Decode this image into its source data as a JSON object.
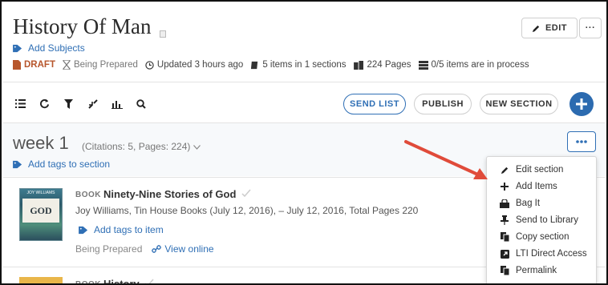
{
  "header": {
    "title": "History Of Man",
    "edit_label": "EDIT",
    "more_label": "···",
    "add_subjects": "Add Subjects"
  },
  "status": {
    "draft": "DRAFT",
    "being_prepared": "Being Prepared",
    "updated": "Updated 3 hours ago",
    "items": "5 items in 1 sections",
    "pages": "224 Pages",
    "process": "0/5 items are in process"
  },
  "toolbar": {
    "send_list": "SEND LIST",
    "publish": "PUBLISH",
    "new_section": "NEW SECTION"
  },
  "section": {
    "title": "week 1",
    "meta": "(Citations: 5, Pages: 224)",
    "add_tags": "Add tags to section"
  },
  "items": [
    {
      "type": "BOOK",
      "title": "Ninety-Nine Stories of God",
      "subtitle": "Joy Williams, Tin House Books (July 12, 2016), – July 12, 2016, Total Pages 220",
      "add_tags": "Add tags to item",
      "status": "Being Prepared",
      "view_online": "View online",
      "cover_text": "GOD",
      "cover_small": "JOY WILLIAMS"
    },
    {
      "type": "BOOK",
      "title": "History"
    }
  ],
  "menu": {
    "items": [
      {
        "label": "Edit section",
        "icon": "pencil-icon"
      },
      {
        "label": "Add Items",
        "icon": "plus-icon"
      },
      {
        "label": "Bag It",
        "icon": "bag-icon"
      },
      {
        "label": "Send to Library",
        "icon": "pin-icon"
      },
      {
        "label": "Copy section",
        "icon": "copy-icon"
      },
      {
        "label": "LTI Direct Access",
        "icon": "external-icon"
      },
      {
        "label": "Permalink",
        "icon": "link-copy-icon"
      }
    ]
  },
  "colors": {
    "link": "#2f6fb5",
    "draft": "#b7562c",
    "primary": "#2c6bb0",
    "arrow": "#e04b3a"
  }
}
